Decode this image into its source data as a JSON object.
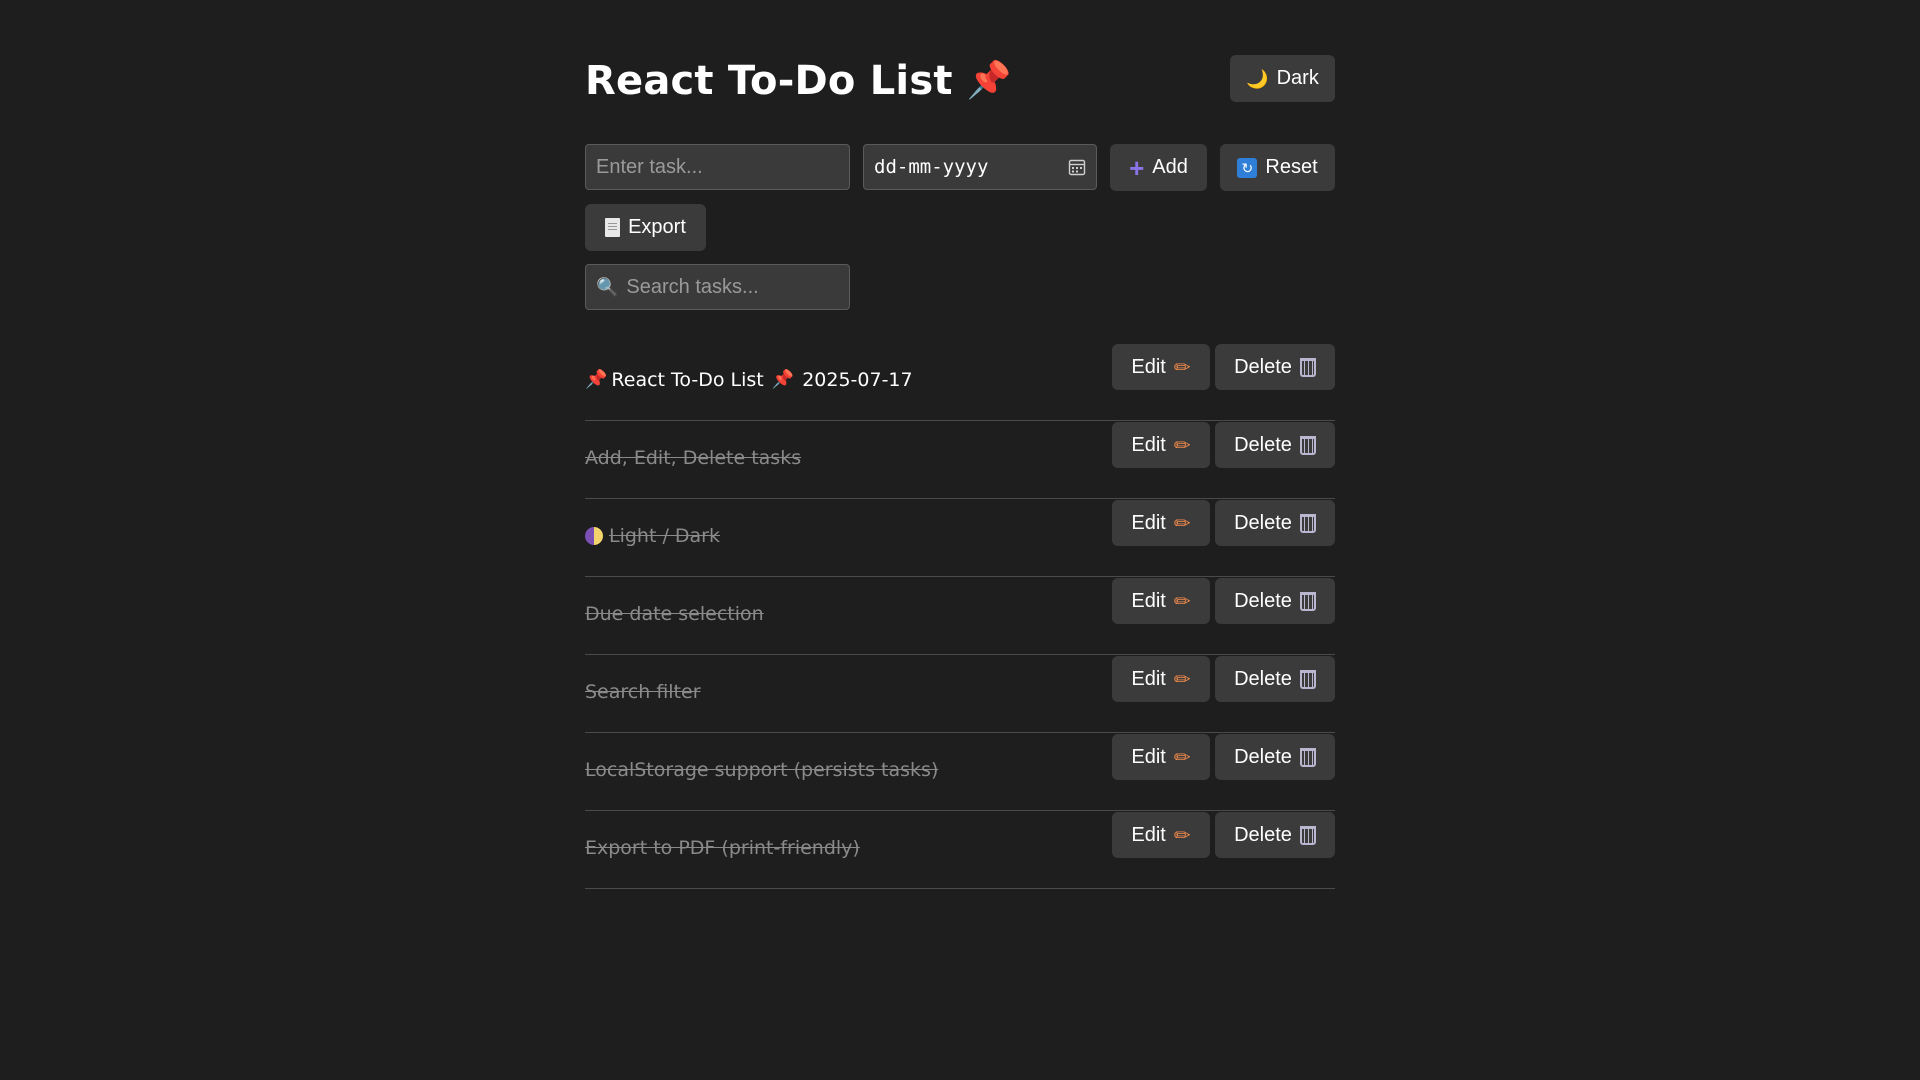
{
  "header": {
    "title": "React To-Do List",
    "title_icon": "pushpin-icon",
    "theme_button": {
      "label": "Dark",
      "icon": "crescent-moon-icon"
    }
  },
  "controls": {
    "task_input": {
      "placeholder": "Enter task...",
      "value": ""
    },
    "date_input": {
      "placeholder": "dd-mm-yyyy",
      "value": ""
    },
    "add_button": {
      "label": "Add",
      "icon": "plus-icon"
    },
    "reset_button": {
      "label": "Reset",
      "icon": "reset-icon"
    },
    "export_button": {
      "label": "Export",
      "icon": "document-icon"
    },
    "search_input": {
      "placeholder": "Search tasks...",
      "icon": "magnifier-icon"
    }
  },
  "tasks": [
    {
      "prefix_icon": "pushpin-icon",
      "text": "React To-Do List",
      "suffix_icon": "pushpin-icon",
      "due": "2025-07-17",
      "completed": false
    },
    {
      "text": "Add, Edit, Delete tasks",
      "completed": true
    },
    {
      "prefix_icon": "half-circle-icon",
      "text": "Light / Dark",
      "completed": true
    },
    {
      "text": "Due date selection",
      "completed": true
    },
    {
      "text": "Search filter",
      "completed": true
    },
    {
      "text": "LocalStorage support (persists tasks)",
      "completed": true
    },
    {
      "text": "Export to PDF (print-friendly)",
      "completed": true
    }
  ],
  "task_actions": {
    "edit_label": "Edit",
    "edit_icon": "pencil-icon",
    "delete_label": "Delete",
    "delete_icon": "wastebasket-icon"
  },
  "colors": {
    "background": "#1e1e1e",
    "button_bg": "#3b3b3b",
    "input_bg": "#3a3a3a",
    "completed_text": "#8a8a8a",
    "divider": "#4a4a4a"
  }
}
